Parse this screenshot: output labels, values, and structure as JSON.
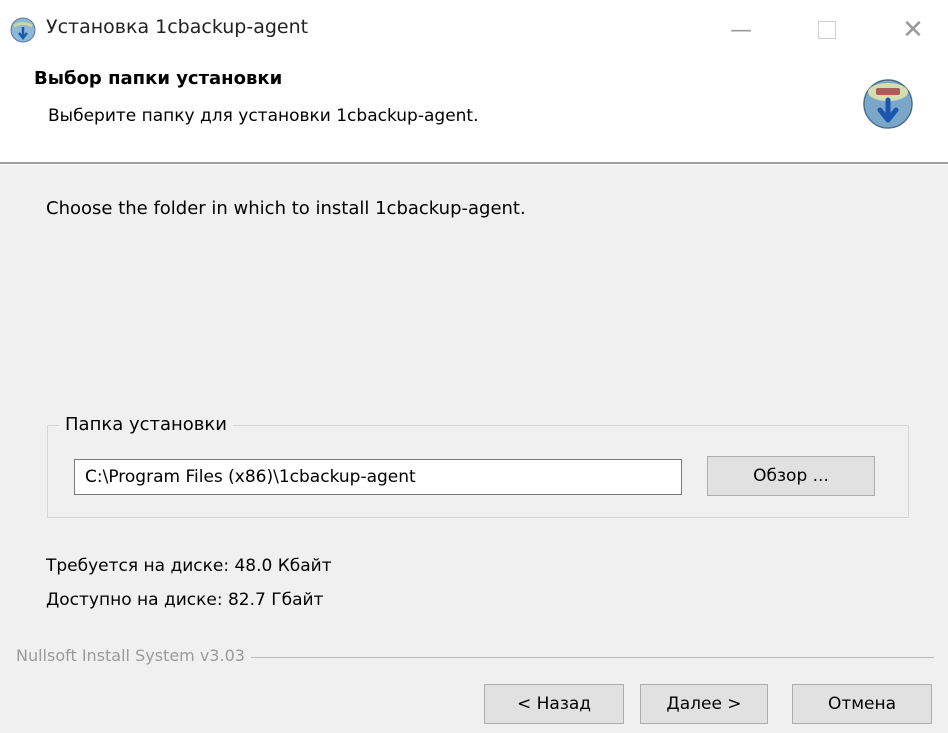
{
  "window": {
    "title": "Установка 1cbackup-agent",
    "icons": {
      "app": "installer-globe-icon",
      "minimize": "minimize-icon",
      "maximize": "maximize-icon",
      "close": "close-icon"
    }
  },
  "header": {
    "title": "Выбор папки установки",
    "subtitle": "Выберите папку для установки 1cbackup-agent.",
    "icon": "installer-globe-icon"
  },
  "body": {
    "description": "Choose the folder in which to install 1cbackup-agent."
  },
  "install_folder": {
    "legend": "Папка установки",
    "path_value": "C:\\Program Files (x86)\\1cbackup-agent",
    "browse_label": "Обзор ..."
  },
  "disk": {
    "required": "Требуется на диске: 48.0 Кбайт",
    "available": "Доступно на диске: 82.7 Гбайт"
  },
  "footer": {
    "brand": "Nullsoft Install System v3.03",
    "back_label": "< Назад",
    "next_label": "Далее >",
    "cancel_label": "Отмена"
  },
  "colors": {
    "background": "#f0f0f0",
    "header_bg": "#ffffff",
    "button_bg": "#e1e1e1",
    "button_border": "#adadad"
  }
}
